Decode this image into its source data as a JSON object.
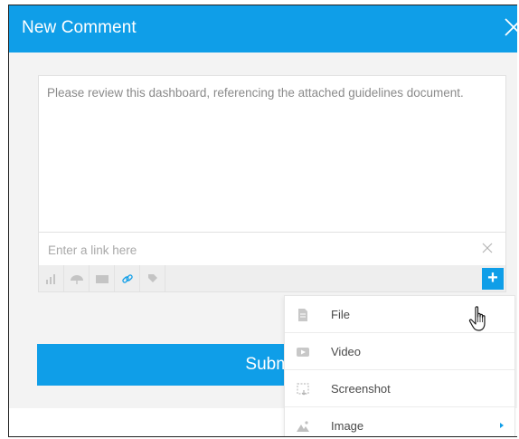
{
  "dialog": {
    "title": "New Comment",
    "close_icon": "close-icon"
  },
  "composer": {
    "comment_text": "Please review this dashboard, referencing the attached guidelines document.",
    "link_placeholder": "Enter a link here",
    "clear_icon": "clear-link-icon",
    "toolbar_icons": [
      "chart-icon",
      "umbrella-icon",
      "panel-icon",
      "link-icon",
      "tag-icon"
    ],
    "add_label": "+"
  },
  "submit": {
    "label": "Submit"
  },
  "attach_menu": {
    "items": [
      {
        "label": "File",
        "icon": "file-icon"
      },
      {
        "label": "Video",
        "icon": "video-icon"
      },
      {
        "label": "Screenshot",
        "icon": "screenshot-icon"
      },
      {
        "label": "Image",
        "icon": "image-icon",
        "has_submenu": true
      }
    ]
  },
  "colors": {
    "accent": "#0f9ee8",
    "panel_bg": "#f3f3f3",
    "toolbar_bg": "#eeeeee"
  }
}
